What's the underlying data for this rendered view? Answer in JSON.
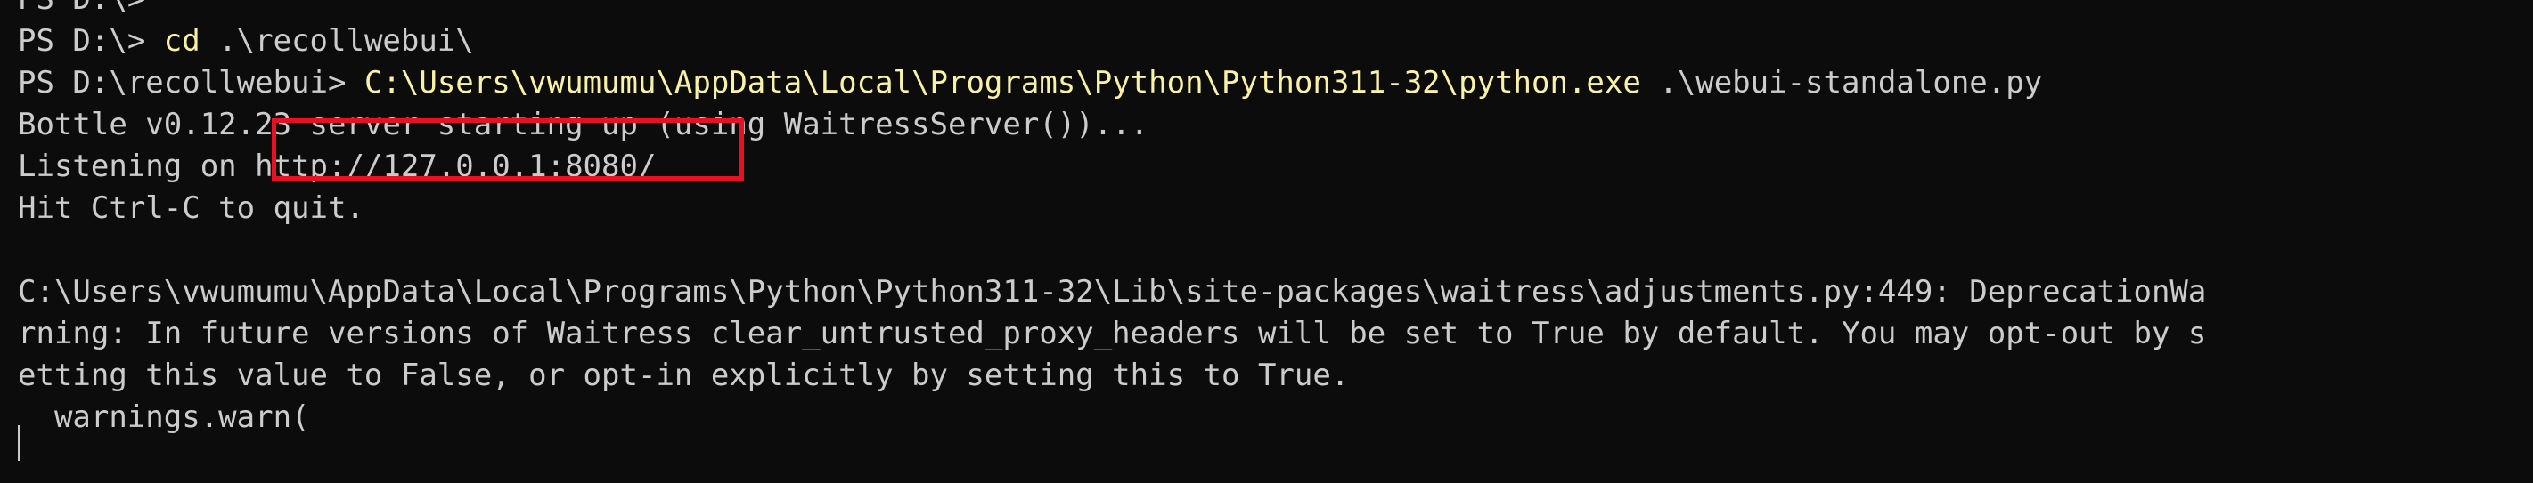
{
  "terminal": {
    "lines": [
      {
        "text": "PS D:\\> ",
        "cmd": "",
        "rest": ""
      },
      {
        "text": "PS D:\\> ",
        "cmd": "cd",
        "rest": " .\\recollwebui\\"
      },
      {
        "text": "PS D:\\recollwebui> ",
        "cmd": "C:\\Users\\vwumumu\\AppData\\Local\\Programs\\Python\\Python311-32\\python.exe",
        "rest": " .\\webui-standalone.py"
      },
      {
        "text": "Bottle v0.12.23 server starting up (using WaitressServer())...",
        "cmd": "",
        "rest": ""
      },
      {
        "text": "Listening on http://127.0.0.1:8080/",
        "cmd": "",
        "rest": ""
      },
      {
        "text": "Hit Ctrl-C to quit.",
        "cmd": "",
        "rest": ""
      },
      {
        "text": "",
        "cmd": "",
        "rest": ""
      },
      {
        "text": "C:\\Users\\vwumumu\\AppData\\Local\\Programs\\Python\\Python311-32\\Lib\\site-packages\\waitress\\adjustments.py:449: DeprecationWa",
        "cmd": "",
        "rest": ""
      },
      {
        "text": "rning: In future versions of Waitress clear_untrusted_proxy_headers will be set to True by default. You may opt-out by s",
        "cmd": "",
        "rest": ""
      },
      {
        "text": "etting this value to False, or opt-in explicitly by setting this to True.",
        "cmd": "",
        "rest": ""
      },
      {
        "text": "  warnings.warn(",
        "cmd": "",
        "rest": ""
      }
    ]
  },
  "colors": {
    "background": "#0c0c0c",
    "foreground": "#cccccc",
    "command": "#f9f1a5",
    "highlight_border": "#e81123"
  }
}
